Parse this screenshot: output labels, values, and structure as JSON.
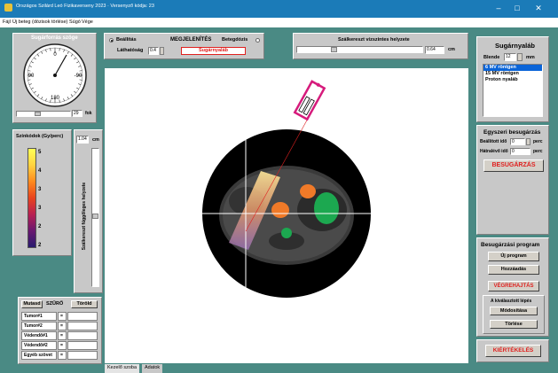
{
  "window": {
    "title": "Országos Szilárd Leó Fizikaverseny 2023 · Versenyző kódja: 23",
    "min": "–",
    "max": "□",
    "close": "✕"
  },
  "menu": [
    "Fájl",
    "Új beteg (dózisok törlése)",
    "Súgó",
    "Vége"
  ],
  "source_angle": {
    "title": "Sugárforrás szöge",
    "dial": {
      "top": "0",
      "left": "90",
      "right": "-90",
      "bottom": "180"
    },
    "value": "29",
    "unit": "fok"
  },
  "display": {
    "radio_setting": "Beállítás",
    "title": "MEGJELENÍTÉS",
    "radio_dose": "Betegdózis",
    "visibility_label": "Láthatóság",
    "visibility_value": "0.4",
    "beam_label": "Sugárnyaláb"
  },
  "crosshair_h": {
    "title": "Szálkereszt vízszintes helyzete",
    "value": "0.64",
    "unit": "cm"
  },
  "color_scale": {
    "title": "Színkódok (Gy/perc)",
    "ticks": [
      "5",
      "4",
      "3",
      "3",
      "2",
      "2"
    ]
  },
  "crosshair_v": {
    "value": "1.04",
    "unit": "cm",
    "label": "Szálkereszt függőleges helyzete"
  },
  "filter": {
    "show": "Mutasd",
    "title": "SZŰRŐ",
    "clear": "Töröld",
    "rows": [
      {
        "name": "Tumor#1",
        "sym": "="
      },
      {
        "name": "Tumor#2",
        "sym": "="
      },
      {
        "name": "Védendő#1",
        "sym": "="
      },
      {
        "name": "Védendő#2",
        "sym": "="
      },
      {
        "name": "Egyéb szövet",
        "sym": "="
      }
    ]
  },
  "tabs": [
    "Kezelő szoba",
    "Adatok"
  ],
  "beam": {
    "title": "Sugárnyaláb",
    "aperture_label": "Blende",
    "aperture_value": "12",
    "aperture_unit": "mm",
    "options": [
      "6 MV röntgen",
      "15 MV röntgen",
      "Proton nyaláb"
    ],
    "selected": 0
  },
  "single": {
    "title": "Egyszeri besugárzás",
    "set_time_label": "Beállított idő",
    "set_time_value": "0",
    "set_time_unit": "perc",
    "remaining_label": "Hátralévő idő",
    "remaining_value": "0",
    "remaining_unit": "perc",
    "irradiate": "BESUGÁRZÁS"
  },
  "program": {
    "title": "Besugárzási program",
    "new": "Új program",
    "add": "Hozzáadás",
    "run": "VÉGREHAJTÁS",
    "selected_step": "A kiválasztott lépés",
    "modify": "Módosítása",
    "delete": "Törlése"
  },
  "evaluate": "KIÉRTÉKELÉS",
  "colors": {
    "titlebar": "#1b7bb8",
    "accent_red": "#e0201e",
    "selection": "#0a64d8"
  }
}
